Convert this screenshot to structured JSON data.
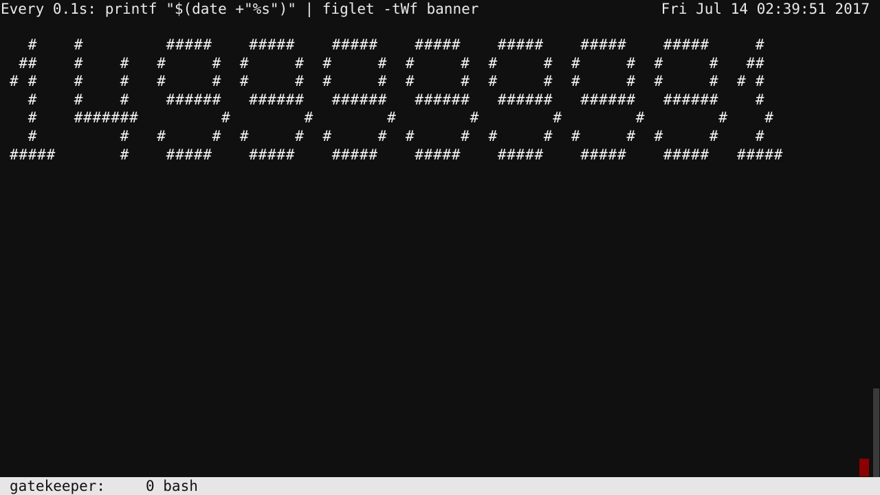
{
  "header": {
    "command": "Every 0.1s: printf \"$(date +\"%s\")\" | figlet -tWf banner",
    "datetime": "Fri Jul 14 02:39:51 2017"
  },
  "output": {
    "banner_text": "  #    #         #####    #####    #####    #####    #####    #####    #####     #\n ##    #    #   #     #  #     #  #     #  #     #  #     #  #     #  #     #   ##\n# #    #    #   #     #  #     #  #     #  #     #  #     #  #     #  #     #  # #\n  #    #    #    ######   ######   ######   ######   ######   ######   ######    #\n  #    #######         #        #        #        #        #        #        #    #\n  #         #   #     #  #     #  #     #  #     #  #     #  #     #  #     #    #\n#####       #    #####    #####    #####    #####    #####    #####    #####   #####"
  },
  "statusbar": {
    "session": "gatekeeper:",
    "window": "0 bash"
  },
  "colors": {
    "background": "#101010",
    "foreground": "#eaeaea",
    "statusbar_bg": "#e6e6e6",
    "cursor": "#8b0000"
  }
}
